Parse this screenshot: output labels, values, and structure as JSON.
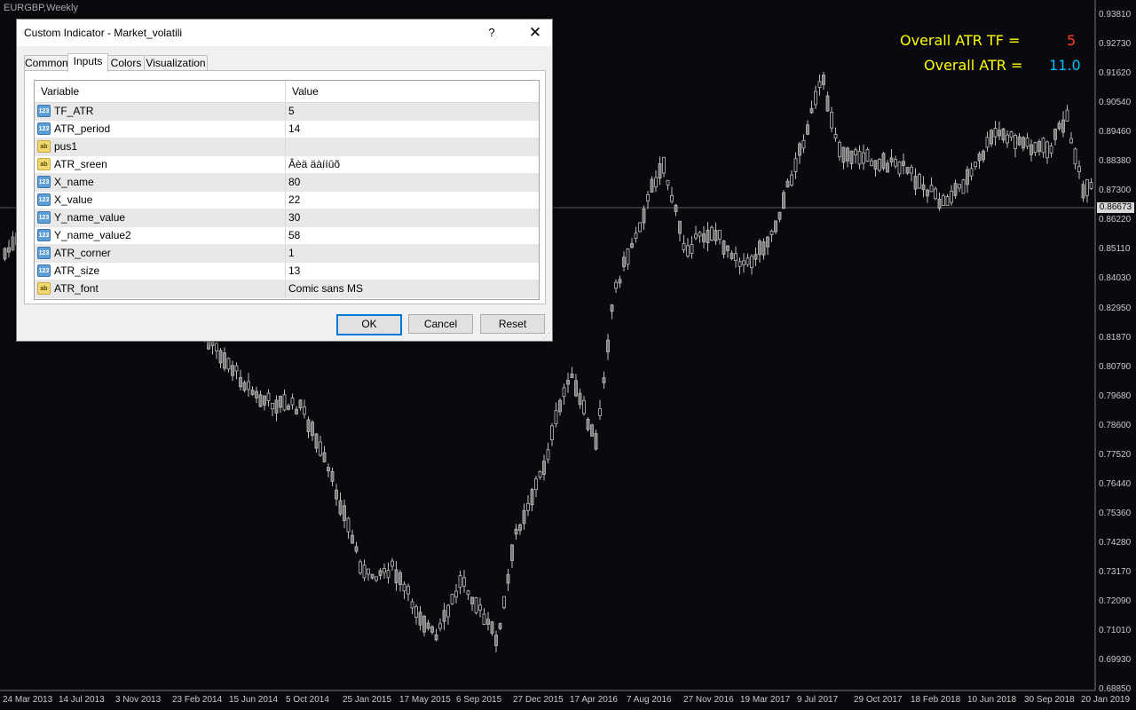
{
  "chart": {
    "symbol": "EURGBP,Weekly",
    "current_price": "0.86673",
    "price_levels": [
      "0.93810",
      "0.92730",
      "0.91620",
      "0.90540",
      "0.89460",
      "0.88380",
      "0.87300",
      "0.86220",
      "0.85110",
      "0.84030",
      "0.82950",
      "0.81870",
      "0.80790",
      "0.79680",
      "0.78600",
      "0.77520",
      "0.76440",
      "0.75360",
      "0.74280",
      "0.73170",
      "0.72090",
      "0.71010",
      "0.69930",
      "0.68850"
    ],
    "dates": [
      "24 Mar 2013",
      "14 Jul 2013",
      "3 Nov 2013",
      "23 Feb 2014",
      "15 Jun 2014",
      "5 Oct 2014",
      "25 Jan 2015",
      "17 May 2015",
      "6 Sep 2015",
      "27 Dec 2015",
      "17 Apr 2016",
      "7 Aug 2016",
      "27 Nov 2016",
      "19 Mar 2017",
      "9 Jul 2017",
      "29 Oct 2017",
      "18 Feb 2018",
      "10 Jun 2018",
      "30 Sep 2018",
      "20 Jan 2019"
    ],
    "colors": {
      "background": "#0a0a0e",
      "candles": "#bdbdbd",
      "axis": "#7a7a7a"
    }
  },
  "indicator": {
    "tf_label": "Overall ATR TF =",
    "tf_value": "5",
    "atr_label": "Overall ATR =",
    "atr_value": "11.0",
    "colors": {
      "label": "#ffff00",
      "tf_value": "#ff3c1e",
      "atr_value": "#00bfff"
    }
  },
  "dialog": {
    "title": "Custom Indicator - Market_volatili",
    "help": "?",
    "tabs": [
      "Common",
      "Inputs",
      "Colors",
      "Visualization"
    ],
    "active_tab": "Inputs",
    "columns": {
      "variable": "Variable",
      "value": "Value"
    },
    "params": [
      {
        "type": "num",
        "icon": "123",
        "name": "TF_ATR",
        "value": "5"
      },
      {
        "type": "num",
        "icon": "123",
        "name": "ATR_period",
        "value": "14"
      },
      {
        "type": "str",
        "icon": "ab",
        "name": "pus1",
        "value": ""
      },
      {
        "type": "str",
        "icon": "ab",
        "name": "ATR_sreen",
        "value": "Âèä äàííûõ"
      },
      {
        "type": "num",
        "icon": "123",
        "name": "X_name",
        "value": "80"
      },
      {
        "type": "num",
        "icon": "123",
        "name": "X_value",
        "value": "22"
      },
      {
        "type": "num",
        "icon": "123",
        "name": "Y_name_value",
        "value": "30"
      },
      {
        "type": "num",
        "icon": "123",
        "name": "Y_name_value2",
        "value": "58"
      },
      {
        "type": "num",
        "icon": "123",
        "name": "ATR_corner",
        "value": "1"
      },
      {
        "type": "num",
        "icon": "123",
        "name": "ATR_size",
        "value": "13"
      },
      {
        "type": "str",
        "icon": "ab",
        "name": "ATR_font",
        "value": "Comic sans MS"
      }
    ],
    "buttons": {
      "ok": "OK",
      "cancel": "Cancel",
      "reset": "Reset"
    }
  }
}
